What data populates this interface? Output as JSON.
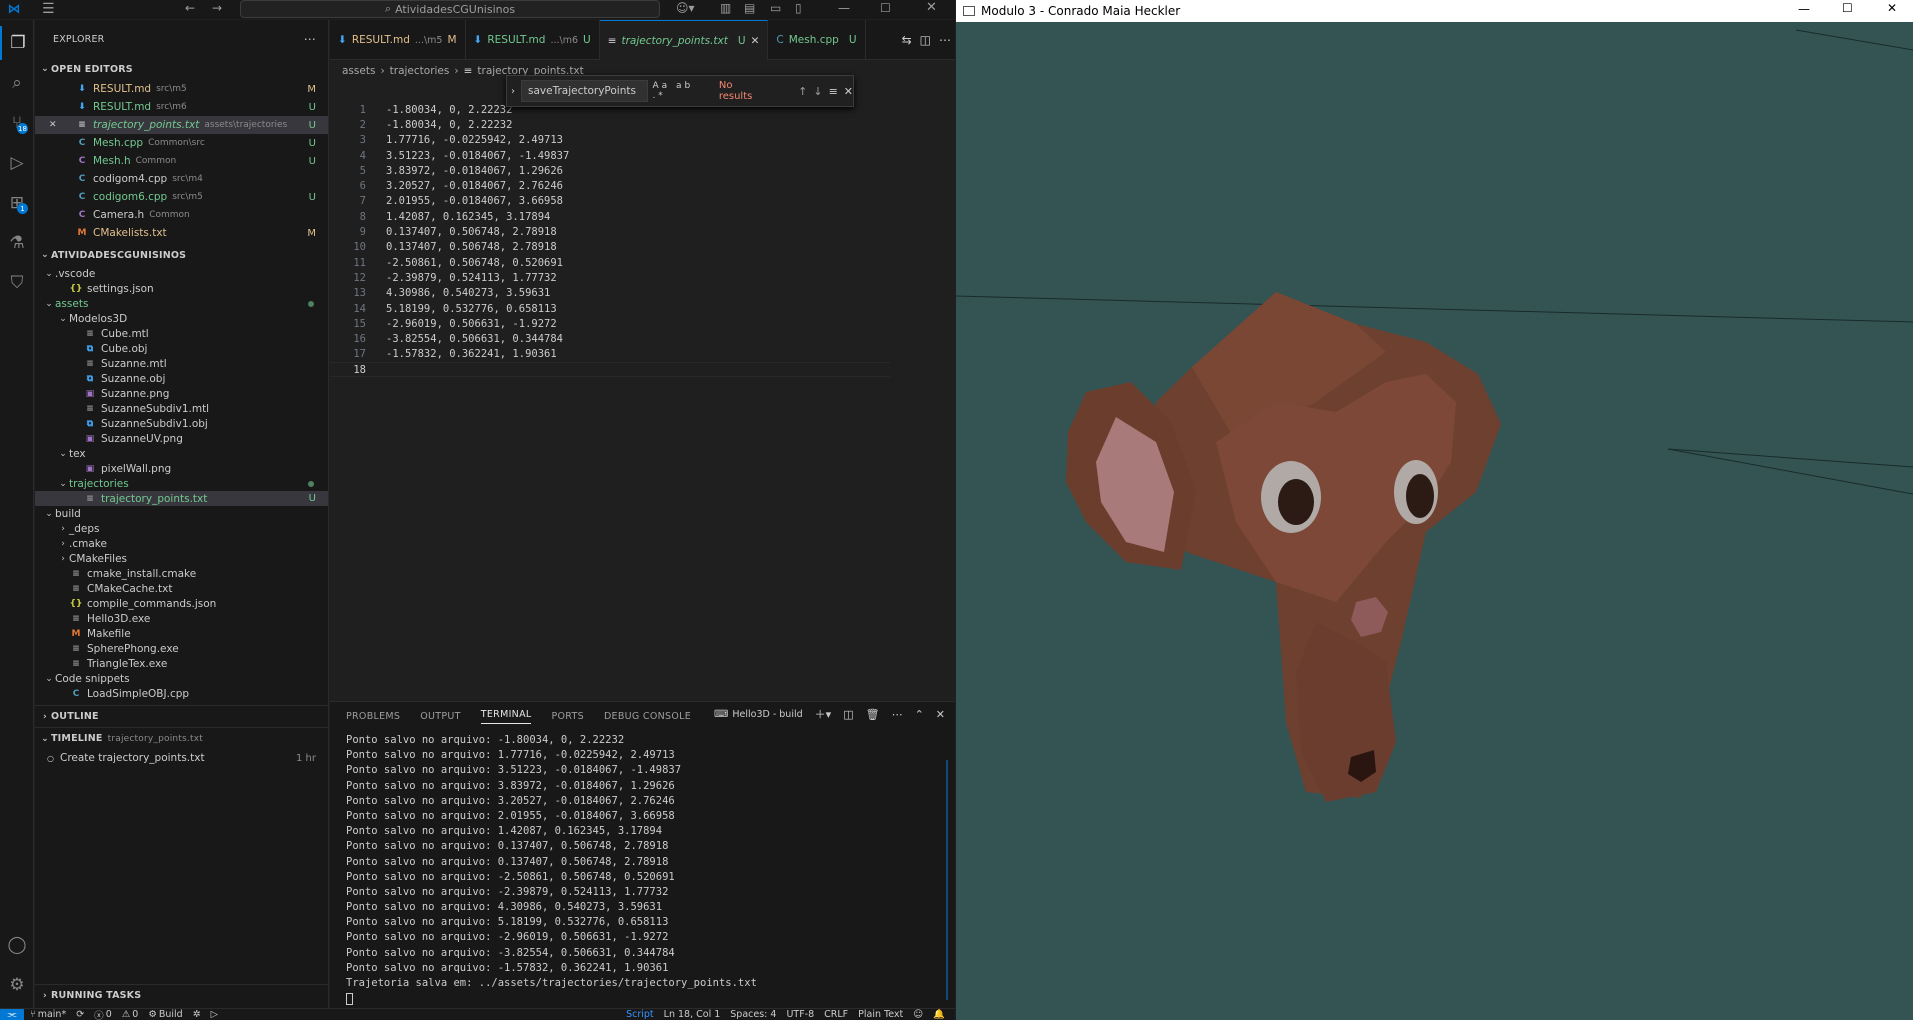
{
  "vscode": {
    "title_search": "AtividadesCGUnisinos",
    "explorer_title": "EXPLORER",
    "open_editors": {
      "header": "OPEN EDITORS",
      "items": [
        {
          "name": "RESULT.md",
          "desc": "src\\m5",
          "status": "M",
          "icon": "markdown-icon",
          "color": "#e2c08d"
        },
        {
          "name": "RESULT.md",
          "desc": "src\\m6",
          "status": "U",
          "icon": "markdown-icon",
          "color": "#73c991"
        },
        {
          "name": "trajectory_points.txt",
          "desc": "assets\\trajectories",
          "status": "U",
          "icon": "text-file-icon",
          "color": "#73c991"
        },
        {
          "name": "Mesh.cpp",
          "desc": "Common\\src",
          "status": "U",
          "icon": "cpp-file-icon",
          "color": "#73c991"
        },
        {
          "name": "Mesh.h",
          "desc": "Common",
          "status": "U",
          "icon": "c-header-icon",
          "color": "#73c991"
        },
        {
          "name": "codigom4.cpp",
          "desc": "src\\m4",
          "status": "",
          "icon": "cpp-file-icon",
          "color": "#cccccc"
        },
        {
          "name": "codigom6.cpp",
          "desc": "src\\m5",
          "status": "U",
          "icon": "cpp-file-icon",
          "color": "#73c991"
        },
        {
          "name": "Camera.h",
          "desc": "Common",
          "status": "",
          "icon": "c-header-icon",
          "color": "#cccccc"
        },
        {
          "name": "CMakelists.txt",
          "desc": "",
          "status": "M",
          "icon": "cmake-icon",
          "color": "#e2c08d"
        }
      ]
    },
    "workspace": {
      "header": "ATIVIDADESCGUNISINOS",
      "tree": [
        {
          "label": ".vscode",
          "depth": 0,
          "type": "folder",
          "open": true
        },
        {
          "label": "settings.json",
          "depth": 1,
          "type": "json"
        },
        {
          "label": "assets",
          "depth": 0,
          "type": "folder",
          "open": true,
          "dot": true,
          "color": "#73c991"
        },
        {
          "label": "Modelos3D",
          "depth": 1,
          "type": "folder",
          "open": true
        },
        {
          "label": "Cube.mtl",
          "depth": 2,
          "type": "file"
        },
        {
          "label": "Cube.obj",
          "depth": 2,
          "type": "obj"
        },
        {
          "label": "Suzanne.mtl",
          "depth": 2,
          "type": "file"
        },
        {
          "label": "Suzanne.obj",
          "depth": 2,
          "type": "obj"
        },
        {
          "label": "Suzanne.png",
          "depth": 2,
          "type": "image"
        },
        {
          "label": "SuzanneSubdiv1.mtl",
          "depth": 2,
          "type": "file"
        },
        {
          "label": "SuzanneSubdiv1.obj",
          "depth": 2,
          "type": "obj"
        },
        {
          "label": "SuzanneUV.png",
          "depth": 2,
          "type": "image"
        },
        {
          "label": "tex",
          "depth": 1,
          "type": "folder",
          "open": true
        },
        {
          "label": "pixelWall.png",
          "depth": 2,
          "type": "image"
        },
        {
          "label": "trajectories",
          "depth": 1,
          "type": "folder",
          "open": true,
          "dot": true,
          "color": "#73c991"
        },
        {
          "label": "trajectory_points.txt",
          "depth": 2,
          "type": "file",
          "status": "U",
          "selected": true,
          "color": "#73c991"
        },
        {
          "label": "build",
          "depth": 0,
          "type": "folder",
          "open": true
        },
        {
          "label": "_deps",
          "depth": 1,
          "type": "folder",
          "open": false
        },
        {
          "label": ".cmake",
          "depth": 1,
          "type": "folder",
          "open": false
        },
        {
          "label": "CMakeFiles",
          "depth": 1,
          "type": "folder",
          "open": false
        },
        {
          "label": "cmake_install.cmake",
          "depth": 1,
          "type": "file"
        },
        {
          "label": "CMakeCache.txt",
          "depth": 1,
          "type": "file"
        },
        {
          "label": "compile_commands.json",
          "depth": 1,
          "type": "json"
        },
        {
          "label": "Hello3D.exe",
          "depth": 1,
          "type": "file"
        },
        {
          "label": "Makefile",
          "depth": 1,
          "type": "makefile"
        },
        {
          "label": "SpherePhong.exe",
          "depth": 1,
          "type": "file"
        },
        {
          "label": "TriangleTex.exe",
          "depth": 1,
          "type": "file"
        },
        {
          "label": "Code snippets",
          "depth": 0,
          "type": "folder",
          "open": true
        },
        {
          "label": "LoadSimpleOBJ.cpp",
          "depth": 1,
          "type": "cpp"
        }
      ]
    },
    "outline_header": "OUTLINE",
    "timeline": {
      "header": "TIMELINE",
      "desc": "trajectory_points.txt",
      "item": "Create trajectory_points.txt",
      "time": "1 hr"
    },
    "running_tasks_header": "RUNNING TASKS",
    "tabs": [
      {
        "label": "RESULT.md",
        "desc": "...\\m5",
        "status": "M",
        "active": false
      },
      {
        "label": "RESULT.md",
        "desc": "...\\m6",
        "status": "U",
        "active": false
      },
      {
        "label": "trajectory_points.txt",
        "desc": "",
        "status": "U",
        "active": true
      },
      {
        "label": "Mesh.cpp",
        "desc": "",
        "status": "U",
        "active": false
      }
    ],
    "breadcrumb": [
      "assets",
      "trajectories",
      "trajectory_points.txt"
    ],
    "find": {
      "query": "saveTrajectoryPoints",
      "result": "No results"
    },
    "code_lines": [
      "-1.80034, 0, 2.22232",
      "-1.80034, 0, 2.22232",
      "1.77716, -0.0225942, 2.49713",
      "3.51223, -0.0184067, -1.49837",
      "3.83972, -0.0184067, 1.29626",
      "3.20527, -0.0184067, 2.76246",
      "2.01955, -0.0184067, 3.66958",
      "1.42087, 0.162345, 3.17894",
      "0.137407, 0.506748, 2.78918",
      "0.137407, 0.506748, 2.78918",
      "-2.50861, 0.506748, 0.520691",
      "-2.39879, 0.524113, 1.77732",
      "4.30986, 0.540273, 3.59631",
      "5.18199, 0.532776, 0.658113",
      "-2.96019, 0.506631, -1.9272",
      "-3.82554, 0.506631, 0.344784",
      "-1.57832, 0.362241, 1.90361",
      ""
    ],
    "panel": {
      "tabs": [
        "PROBLEMS",
        "OUTPUT",
        "TERMINAL",
        "PORTS",
        "DEBUG CONSOLE"
      ],
      "active_tab": "TERMINAL",
      "terminal_name": "Hello3D - build",
      "lines": [
        "Ponto salvo no arquivo: -1.80034, 0, 2.22232",
        "Ponto salvo no arquivo: 1.77716, -0.0225942, 2.49713",
        "Ponto salvo no arquivo: 3.51223, -0.0184067, -1.49837",
        "Ponto salvo no arquivo: 3.83972, -0.0184067, 1.29626",
        "Ponto salvo no arquivo: 3.20527, -0.0184067, 2.76246",
        "Ponto salvo no arquivo: 2.01955, -0.0184067, 3.66958",
        "Ponto salvo no arquivo: 1.42087, 0.162345, 3.17894",
        "Ponto salvo no arquivo: 0.137407, 0.506748, 2.78918",
        "Ponto salvo no arquivo: 0.137407, 0.506748, 2.78918",
        "Ponto salvo no arquivo: -2.50861, 0.506748, 0.520691",
        "Ponto salvo no arquivo: -2.39879, 0.524113, 1.77732",
        "Ponto salvo no arquivo: 4.30986, 0.540273, 3.59631",
        "Ponto salvo no arquivo: 5.18199, 0.532776, 0.658113",
        "Ponto salvo no arquivo: -2.96019, 0.506631, -1.9272",
        "Ponto salvo no arquivo: -3.82554, 0.506631, 0.344784",
        "Ponto salvo no arquivo: -1.57832, 0.362241, 1.90361",
        "Trajetoria salva em: ../assets/trajectories/trajectory_points.txt"
      ]
    },
    "status": {
      "branch": "main*",
      "errors": "0",
      "warnings": "0",
      "build": "Build",
      "language_mode": "Script",
      "position": "Ln 18, Col 1",
      "spaces": "Spaces: 4",
      "encoding": "UTF-8",
      "eol": "CRLF",
      "file_type": "Plain Text"
    },
    "badges": {
      "source_control": "18",
      "extensions": "1"
    }
  },
  "gl_window": {
    "title": "Modulo 3 - Conrado Maia Heckler",
    "background": "#335453",
    "model_color": "#6b3d2e"
  }
}
